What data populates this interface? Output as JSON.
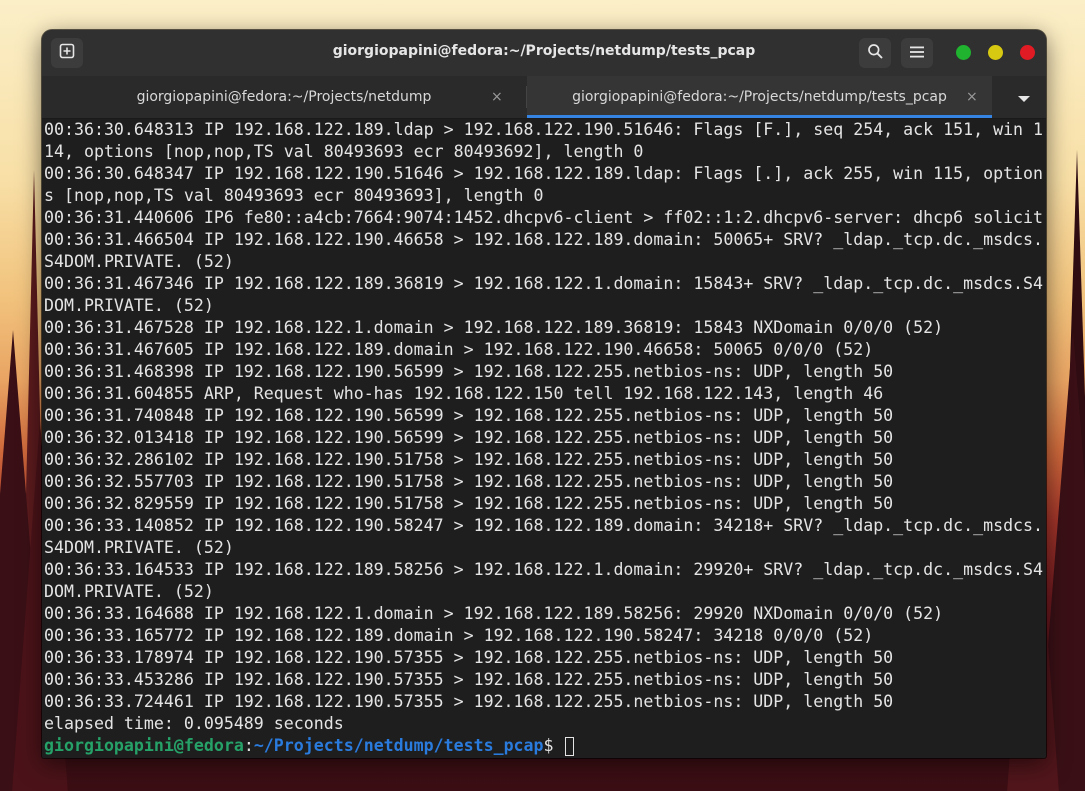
{
  "window": {
    "title": "giorgiopapini@fedora:~/Projects/netdump/tests_pcap",
    "icons": {
      "new_tab": "new-tab-icon",
      "search": "search-icon",
      "menu": "hamburger-menu-icon",
      "minimize": "minimize-icon",
      "maximize": "maximize-icon",
      "close": "close-icon"
    },
    "control_colors": {
      "minimize": "#1fb32f",
      "maximize": "#d7c911",
      "close": "#e01b24"
    }
  },
  "tabs": [
    {
      "label": "giorgiopapini@fedora:~/Projects/netdump",
      "close": "×",
      "active": false
    },
    {
      "label": "giorgiopapini@fedora:~/Projects/netdump/tests_pcap",
      "close": "×",
      "active": true
    }
  ],
  "tab_dropdown_icon": "chevron-down-icon",
  "accent_color": "#3584e4",
  "terminal": {
    "lines": [
      "00:36:30.648313 IP 192.168.122.189.ldap > 192.168.122.190.51646: Flags [F.], seq 254, ack 151, win 1",
      "14, options [nop,nop,TS val 80493693 ecr 80493692], length 0",
      "00:36:30.648347 IP 192.168.122.190.51646 > 192.168.122.189.ldap: Flags [.], ack 255, win 115, option",
      "s [nop,nop,TS val 80493693 ecr 80493693], length 0",
      "00:36:31.440606 IP6 fe80::a4cb:7664:9074:1452.dhcpv6-client > ff02::1:2.dhcpv6-server: dhcp6 solicit",
      "00:36:31.466504 IP 192.168.122.190.46658 > 192.168.122.189.domain: 50065+ SRV? _ldap._tcp.dc._msdcs.",
      "S4DOM.PRIVATE. (52)",
      "00:36:31.467346 IP 192.168.122.189.36819 > 192.168.122.1.domain: 15843+ SRV? _ldap._tcp.dc._msdcs.S4",
      "DOM.PRIVATE. (52)",
      "00:36:31.467528 IP 192.168.122.1.domain > 192.168.122.189.36819: 15843 NXDomain 0/0/0 (52)",
      "00:36:31.467605 IP 192.168.122.189.domain > 192.168.122.190.46658: 50065 0/0/0 (52)",
      "00:36:31.468398 IP 192.168.122.190.56599 > 192.168.122.255.netbios-ns: UDP, length 50",
      "00:36:31.604855 ARP, Request who-has 192.168.122.150 tell 192.168.122.143, length 46",
      "00:36:31.740848 IP 192.168.122.190.56599 > 192.168.122.255.netbios-ns: UDP, length 50",
      "00:36:32.013418 IP 192.168.122.190.56599 > 192.168.122.255.netbios-ns: UDP, length 50",
      "00:36:32.286102 IP 192.168.122.190.51758 > 192.168.122.255.netbios-ns: UDP, length 50",
      "00:36:32.557703 IP 192.168.122.190.51758 > 192.168.122.255.netbios-ns: UDP, length 50",
      "00:36:32.829559 IP 192.168.122.190.51758 > 192.168.122.255.netbios-ns: UDP, length 50",
      "00:36:33.140852 IP 192.168.122.190.58247 > 192.168.122.189.domain: 34218+ SRV? _ldap._tcp.dc._msdcs.",
      "S4DOM.PRIVATE. (52)",
      "00:36:33.164533 IP 192.168.122.189.58256 > 192.168.122.1.domain: 29920+ SRV? _ldap._tcp.dc._msdcs.S4",
      "DOM.PRIVATE. (52)",
      "00:36:33.164688 IP 192.168.122.1.domain > 192.168.122.189.58256: 29920 NXDomain 0/0/0 (52)",
      "00:36:33.165772 IP 192.168.122.189.domain > 192.168.122.190.58247: 34218 0/0/0 (52)",
      "00:36:33.178974 IP 192.168.122.190.57355 > 192.168.122.255.netbios-ns: UDP, length 50",
      "00:36:33.453286 IP 192.168.122.190.57355 > 192.168.122.255.netbios-ns: UDP, length 50",
      "00:36:33.724461 IP 192.168.122.190.57355 > 192.168.122.255.netbios-ns: UDP, length 50",
      "elapsed time: 0.095489 seconds"
    ],
    "prompt": {
      "user_host": "giorgiopapini@fedora",
      "colon": ":",
      "path": "~/Projects/netdump/tests_pcap",
      "symbol": "$ "
    },
    "colors": {
      "background": "#1e1e1e",
      "foreground": "#e4e4e4",
      "prompt_user": "#26a269",
      "prompt_path": "#2a7bde"
    }
  }
}
